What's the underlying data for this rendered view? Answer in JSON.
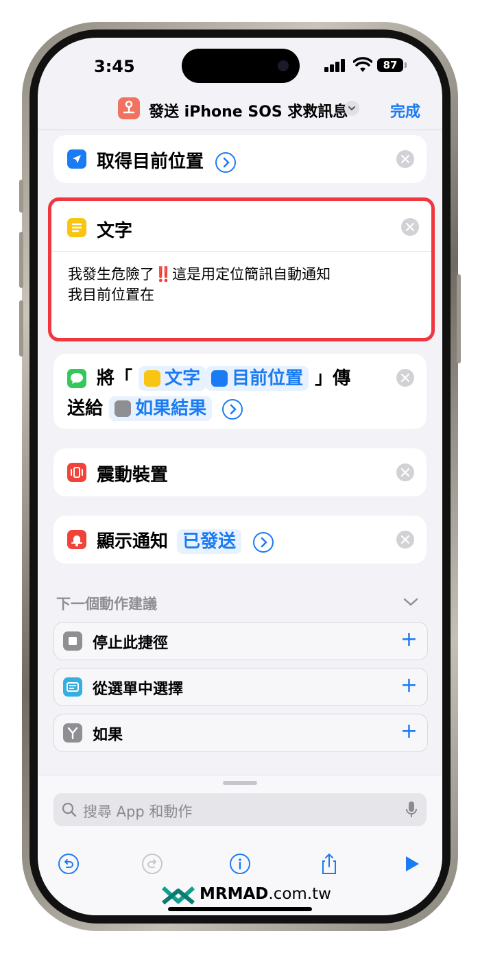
{
  "status": {
    "time": "3:45",
    "battery": "87"
  },
  "nav": {
    "title": "發送 iPhone SOS 求救訊息",
    "done": "完成"
  },
  "actions": {
    "location": {
      "title": "取得目前位置"
    },
    "text": {
      "title": "文字",
      "line1_a": "我發生危險了",
      "emoji": "‼️",
      "line1_b": "這是用定位簡訊自動通知",
      "line2": "我目前位置在"
    },
    "send": {
      "prefix": "將「",
      "var_text": "文字",
      "var_location": "目前位置",
      "suffix": "」傳",
      "line2_prefix": "送給",
      "var_result": "如果結果"
    },
    "vibrate": {
      "title": "震動裝置"
    },
    "notify": {
      "title": "顯示通知",
      "var_sent": "已發送"
    }
  },
  "suggestions": {
    "header": "下一個動作建議",
    "items": [
      {
        "label": "停止此捷徑",
        "icon": "stop-icon"
      },
      {
        "label": "從選單中選擇",
        "icon": "menu-icon"
      },
      {
        "label": "如果",
        "icon": "if-icon"
      }
    ]
  },
  "search": {
    "placeholder": "搜尋 App 和動作"
  },
  "watermark": {
    "brand": "MRMAD",
    "domain": ".com.tw"
  },
  "colors": {
    "accent": "#1a7bf2",
    "highlight": "#f0363e"
  }
}
